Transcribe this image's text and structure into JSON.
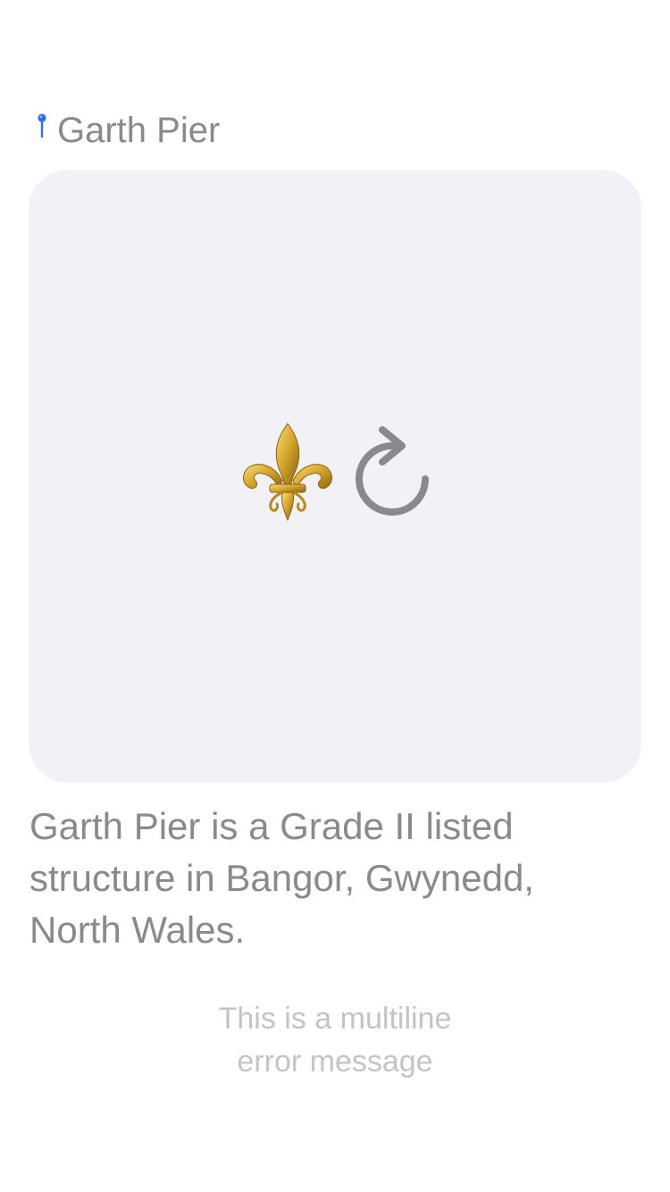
{
  "header": {
    "icon": "location-pin-icon",
    "title": "Garth Pier"
  },
  "image_card": {
    "placeholder_icon": "fleur-de-lis-icon",
    "action_icon": "reload-icon"
  },
  "description": "Garth Pier is a Grade II listed structure in Bangor, Gwynedd, North Wales.",
  "error": {
    "line1": "This is a multiline",
    "line2": "error message"
  },
  "colors": {
    "background": "#ffffff",
    "card": "#f2f1f6",
    "text_secondary": "#8a8a8e",
    "text_tertiary": "#c4c4c6",
    "pin": "#2f6fe0",
    "gold": "#d4a72c"
  }
}
